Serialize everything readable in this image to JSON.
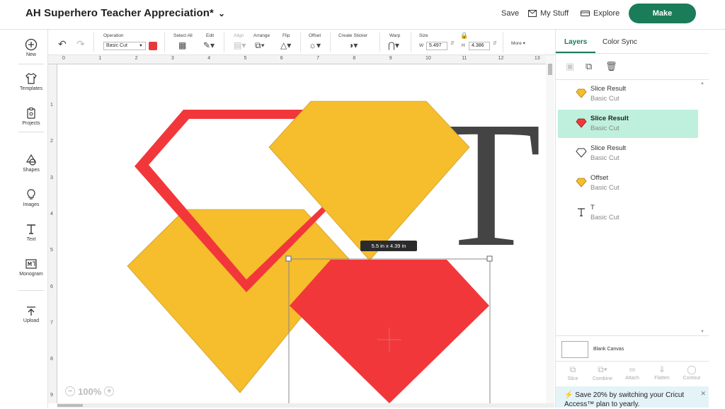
{
  "app": {
    "project_title": "AH Superhero Teacher Appreciation*",
    "top_links": {
      "save": "Save",
      "my_stuff": "My Stuff",
      "explore": "Explore"
    },
    "make_label": "Make",
    "brand_color": "#1a7c58"
  },
  "sidebar": {
    "items": [
      {
        "label": "New",
        "icon": "plus-circle-icon"
      },
      {
        "label": "Templates",
        "icon": "shirt-icon"
      },
      {
        "label": "Projects",
        "icon": "clipboard-icon"
      },
      {
        "label": "Shapes",
        "icon": "shapes-icon"
      },
      {
        "label": "Images",
        "icon": "bulb-icon"
      },
      {
        "label": "Text",
        "icon": "text-icon"
      },
      {
        "label": "Monogram",
        "icon": "monogram-icon"
      },
      {
        "label": "Upload",
        "icon": "upload-icon"
      }
    ]
  },
  "toolbar": {
    "operation_label": "Operation",
    "operation_value": "Basic Cut",
    "operation_color": "#e8393a",
    "select_all": "Select All",
    "edit": "Edit",
    "align": "Align",
    "arrange": "Arrange",
    "flip": "Flip",
    "offset": "Offset",
    "create_sticker": "Create Sticker",
    "warp": "Warp",
    "size": "Size",
    "width_label": "W",
    "width_value": "5.497",
    "height_label": "H",
    "height_value": "4.386",
    "more": "More"
  },
  "rulers": {
    "top": [
      "0",
      "1",
      "2",
      "3",
      "4",
      "5",
      "6",
      "7",
      "8",
      "9",
      "10",
      "11",
      "12",
      "13"
    ],
    "left": [
      "1",
      "2",
      "3",
      "4",
      "5",
      "6",
      "7",
      "8",
      "9"
    ]
  },
  "canvas": {
    "selection_dimensions": "5.5  in x 4.39  in",
    "zoom": "100%",
    "letter": "T",
    "shape_colors": {
      "gold": "#f6bd2c",
      "red": "#f2373a",
      "dark": "#444444"
    }
  },
  "layers_panel": {
    "tabs": [
      "Layers",
      "Color Sync"
    ],
    "layers": [
      {
        "name": "Slice Result",
        "operation": "Basic Cut",
        "icon": "gold-diamond-icon",
        "selected": false
      },
      {
        "name": "Slice Result",
        "operation": "Basic Cut",
        "icon": "red-diamond-icon",
        "selected": true
      },
      {
        "name": "Slice Result",
        "operation": "Basic Cut",
        "icon": "outline-diamond-icon",
        "selected": false
      },
      {
        "name": "Offset",
        "operation": "Basic Cut",
        "icon": "gold-diamond-icon",
        "selected": false
      },
      {
        "name": "T",
        "operation": "Basic Cut",
        "icon": "text-icon",
        "selected": false
      }
    ],
    "blank_canvas": "Blank Canvas",
    "bottom_tools": [
      "Slice",
      "Combine",
      "Attach",
      "Flatten",
      "Contour"
    ],
    "promo": "Save 20% by switching your Cricut Access™ plan to yearly."
  }
}
